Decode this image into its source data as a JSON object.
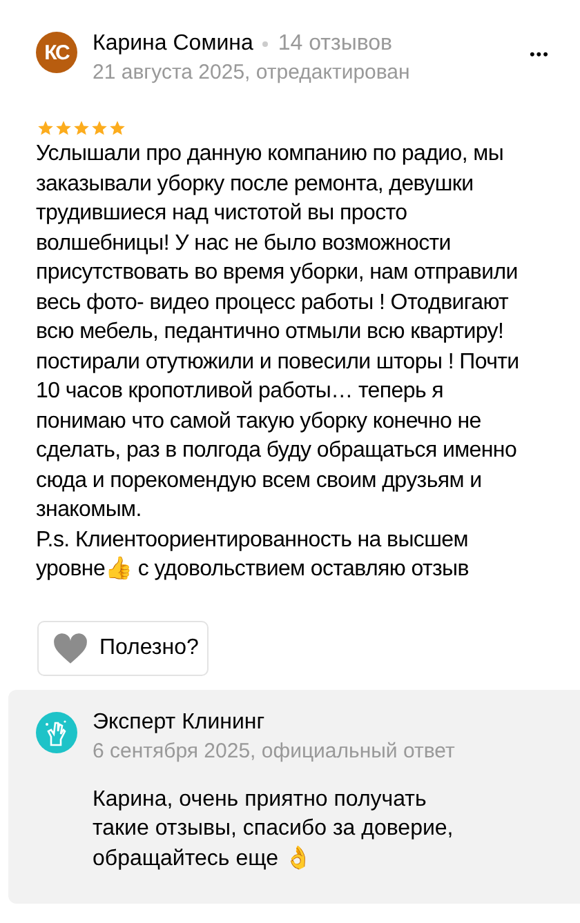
{
  "review": {
    "author": {
      "initials": "КС",
      "name": "Карина Сомина",
      "reviews_count": "14 отзывов"
    },
    "date": "21 августа 2025, отредактирован",
    "menu": "•••",
    "stars": 5,
    "text": "Услышали про данную компанию по радио, мы заказывали уборку после ремонта, девушки трудившиеся над чистотой вы просто волшебницы! У нас не было возможности присутствовать во время уборки, нам отправили весь фото- видео процесс работы ! Отодвигают всю мебель, педантично отмыли всю квартиру! постирали отутюжили и повесили шторы ! Почти 10 часов кропотливой работы… теперь я понимаю что самой такую уборку конечно не сделать, раз в полгода буду обращаться именно сюда и порекомендую всем своим друзьям и знакомым.\nP.s. Клиентоориентированность на высшем уровне👍 с удовольствием оставляю отзыв",
    "helpful_button": "Полезно?"
  },
  "reply": {
    "name": "Эксперт Клининг",
    "date": "6 сентября 2025, официальный ответ",
    "text": "Карина, очень приятно получать такие отзывы, спасибо за доверие, обращайтесь еще 👌"
  }
}
